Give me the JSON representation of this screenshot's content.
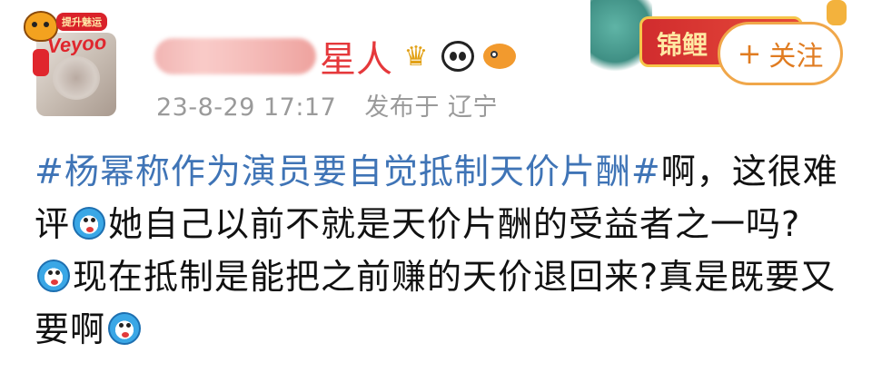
{
  "author": {
    "name_visible": "星人",
    "avatar_frame_text": "Veyoo",
    "avatar_badge_text": "提升魅运"
  },
  "meta": {
    "date": "23-8-29 17:17",
    "location": "发布于 辽宁"
  },
  "decor": {
    "banner_text": "锦鲤"
  },
  "follow_button": {
    "icon": "+",
    "label": "关注"
  },
  "post": {
    "hashtag": "#杨幂称作为演员要自觉抵制天价片酬#",
    "text1": "啊，这很难评",
    "text2": "她自己以前不就是天价片酬的受益者之一吗?",
    "text3": "现在抵制是能把之前赚的天价退回来?真是既要又要啊",
    "emoji_name": "doraemon-emoji"
  }
}
